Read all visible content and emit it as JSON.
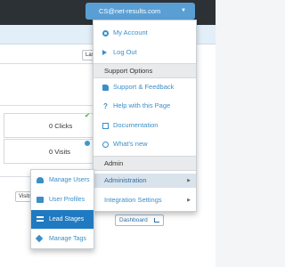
{
  "header": {
    "user_email": "CS@net-results.com",
    "caret": "▼"
  },
  "toolbar": {
    "last_button": "Last",
    "visits_button": "Visits"
  },
  "stats": [
    {
      "label": "0 Clicks"
    },
    {
      "label": "0 Visits"
    }
  ],
  "dashboard_button": "Dashboard",
  "user_menu": {
    "items_top": [
      {
        "label": "My Account",
        "icon": "gears-icon"
      },
      {
        "label": "Log Out",
        "icon": "logout-icon"
      }
    ],
    "support_header": "Support Options",
    "support_items": [
      {
        "label": "Support & Feedback",
        "icon": "thumbs-up-icon"
      },
      {
        "label": "Help with this Page",
        "icon": "question-icon"
      },
      {
        "label": "Documentation",
        "icon": "document-icon"
      },
      {
        "label": "What's new",
        "icon": "circle-icon"
      }
    ],
    "admin_header": "Admin",
    "admin_items": [
      {
        "label": "Administration",
        "chevron": "▶"
      },
      {
        "label": "Integration Settings",
        "chevron": "▶"
      }
    ]
  },
  "admin_submenu": {
    "items": [
      {
        "label": "Manage Users",
        "icon": "users-icon"
      },
      {
        "label": "User Profiles",
        "icon": "profile-icon"
      },
      {
        "label": "Lead Stages",
        "icon": "list-icon"
      },
      {
        "label": "Manage Tags",
        "icon": "tags-icon"
      }
    ]
  },
  "colors": {
    "topbar": "#2b3135",
    "accent": "#5a9fd4",
    "link": "#3a8fc7",
    "selected": "#1f7ac1"
  }
}
